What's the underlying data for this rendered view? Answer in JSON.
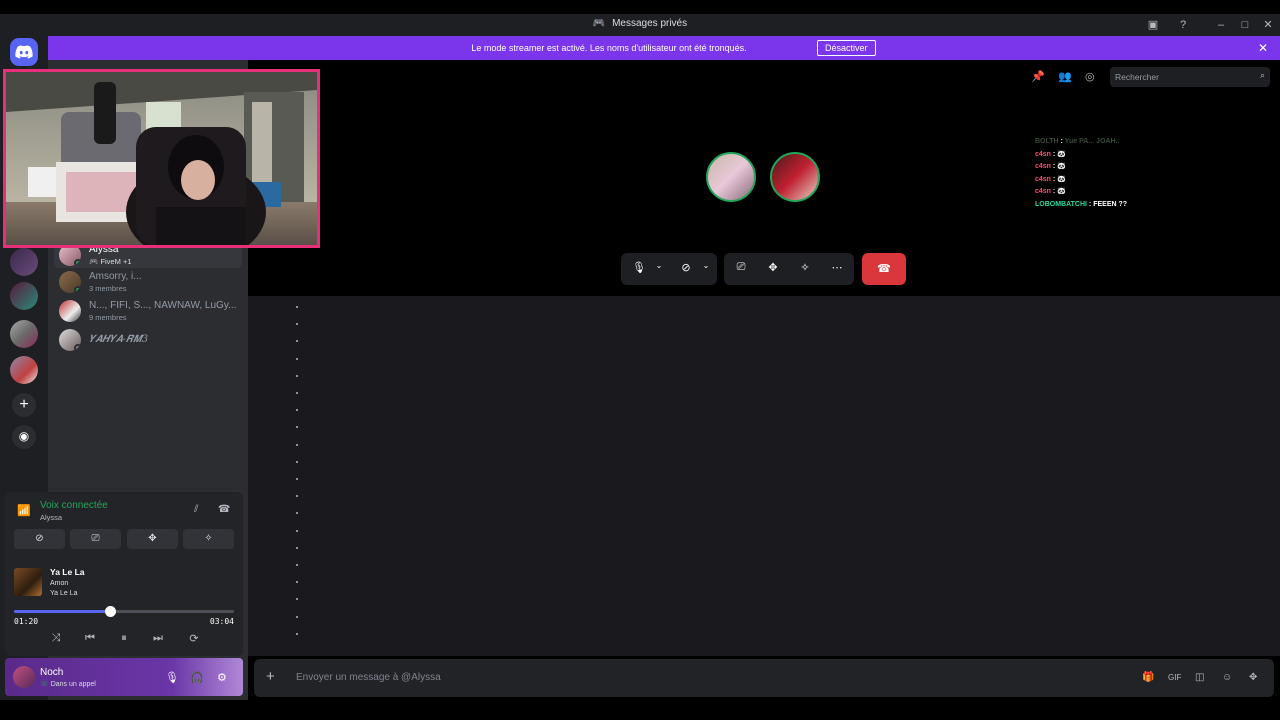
{
  "window": {
    "title": "Messages privés"
  },
  "banner": {
    "message": "Le mode streamer est activé. Les noms d'utilisateur ont été tronqués.",
    "button": "Désactiver",
    "close": "✕"
  },
  "dm_list": [
    {
      "name": "Alyssa",
      "sub": "FiveM +1",
      "status": "online"
    },
    {
      "name": "Amsorry, i...",
      "sub": "3 membres",
      "status": "online"
    },
    {
      "name": "N..., FIFI, S..., NAWNAW, LuGy...",
      "sub": "9 membres",
      "status": "none"
    },
    {
      "name": "𝒀𝑨𝑯𝒀𝑨-𝑹𝑴3",
      "sub": "",
      "status": "offline"
    }
  ],
  "voice": {
    "title": "Voix connectée",
    "channel": "Alyssa"
  },
  "music": {
    "title": "Ya Le La",
    "artist": "Amon",
    "album": "Ya Le La",
    "current": "01:20",
    "duration": "03:04",
    "progress": 0.435
  },
  "user": {
    "name": "Noch",
    "status": "Dans un appel"
  },
  "header": {
    "search_placeholder": "Rechercher"
  },
  "overlay_chat": [
    {
      "user": "BOLTH",
      "text": "Yue PA... JOAH..",
      "style": "dim"
    },
    {
      "user": "c4sn",
      "text": "🐼",
      "style": "red"
    },
    {
      "user": "c4sn",
      "text": "🐼",
      "style": "red"
    },
    {
      "user": "c4sn",
      "text": "🐼",
      "style": "red"
    },
    {
      "user": "c4sn",
      "text": "🐼",
      "style": "red"
    },
    {
      "user": "LOBOMBATCHI",
      "text": "FEEEN ??",
      "style": "green"
    }
  ],
  "composer": {
    "placeholder": "Envoyer un message à @Alyssa"
  },
  "colors": {
    "accent": "#5865f2",
    "banner": "#7b35ea",
    "connected": "#23a55a",
    "hangup": "#da373c",
    "webcam_border": "#e8307a"
  }
}
